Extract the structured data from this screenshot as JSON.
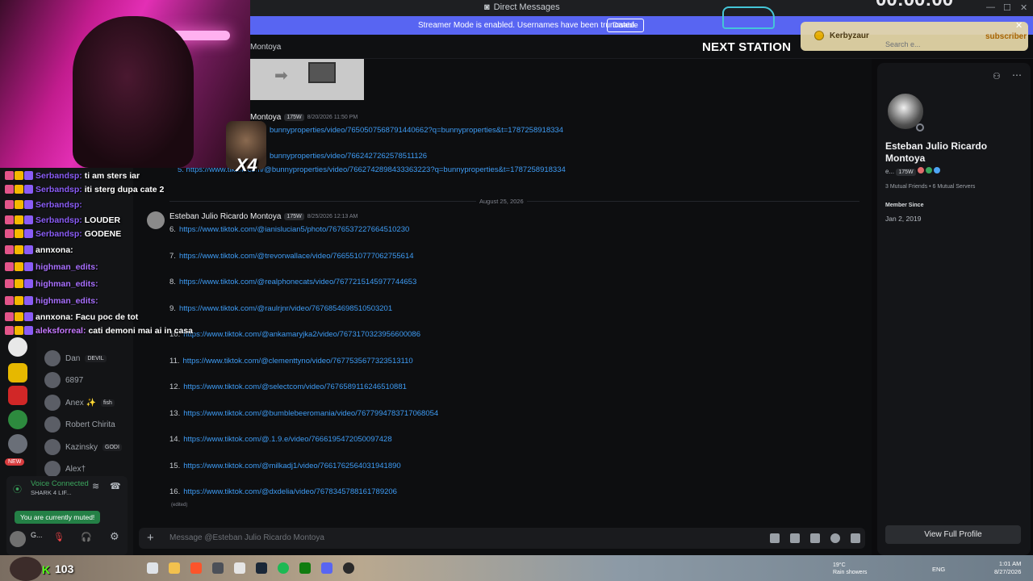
{
  "window": {
    "title": "Direct Messages",
    "controls": [
      "—",
      "☐",
      "✕"
    ]
  },
  "banner": {
    "message": "Streamer Mode is enabled. Usernames have been truncated.",
    "disable_label": "Disable"
  },
  "header": {
    "dm_name": "Montoya"
  },
  "overlay": {
    "next_station": "NEXT STATION",
    "timer": "00:00:00",
    "sub_alert": {
      "user": "Kerbyzaur",
      "type": "subscriber"
    },
    "search_placeholder": "Search e...",
    "viewers": "103",
    "multiplier": "X4"
  },
  "chat_overlay": [
    {
      "user": "Serbandsp:",
      "text": "ti am sters iar",
      "color": "#8a5cf6"
    },
    {
      "user": "Serbandsp:",
      "text": "iti sterg dupa cate 2",
      "color": "#8a5cf6"
    },
    {
      "user": "Serbandsp:",
      "text": "",
      "color": "#8a5cf6"
    },
    {
      "user": "Serbandsp:",
      "text": "LOUDER",
      "color": "#8a5cf6"
    },
    {
      "user": "Serbandsp:",
      "text": "GODENE",
      "color": "#8a5cf6"
    },
    {
      "user": "annxona:",
      "text": "",
      "color": "#ffffff"
    },
    {
      "user": "highman_edits:",
      "text": "",
      "color": "#a970ff"
    },
    {
      "user": "highman_edits:",
      "text": "",
      "color": "#a970ff"
    },
    {
      "user": "highman_edits:",
      "text": "",
      "color": "#a970ff"
    },
    {
      "user": "annxona:",
      "text": "Facu poc de tot",
      "color": "#ffffff"
    },
    {
      "user": "aleksforreal:",
      "text": "cati demoni mai ai in casa",
      "color": "#c678ff"
    }
  ],
  "dm_list": [
    {
      "name": "Dan",
      "tag": "DEVIL"
    },
    {
      "name": "6897",
      "tag": ""
    },
    {
      "name": "Anex ✨",
      "tag": "fish"
    },
    {
      "name": "Robert Chirita",
      "tag": ""
    },
    {
      "name": "Kazinsky",
      "tag": "GODI"
    },
    {
      "name": "Alex†",
      "tag": ""
    }
  ],
  "voice": {
    "status": "Voice Connected",
    "channel": "SHARK 4 LIF...",
    "muted_tooltip": "You are currently muted!",
    "user_short": "G..."
  },
  "messages": {
    "author": "Esteban Julio Ricardo Montoya",
    "author_short": "Montoya",
    "badge": "175W",
    "first_ts": "8/20/2026 11:50 PM",
    "first_links": [
      "bunnyproperties/video/7650507568791440662?q=bunnyproperties&t=1787258918334",
      "bunnyproperties/video/7662427262578511126",
      "5. https://www.tiktok.com/@bunnyproperties/video/7662742898433363223?q=bunnyproperties&t=1787258918334"
    ],
    "divider": "August 25, 2026",
    "second_ts": "8/25/2026 12:13 AM",
    "numbered": [
      {
        "n": "6.",
        "url": "https://www.tiktok.com/@ianislucian5/photo/7676537227664510230"
      },
      {
        "n": "7.",
        "url": "https://www.tiktok.com/@trevorwallace/video/7665510777062755614"
      },
      {
        "n": "8.",
        "url": "https://www.tiktok.com/@realphonecats/video/7677215145977744653"
      },
      {
        "n": "9.",
        "url": "https://www.tiktok.com/@raulrjnr/video/7676854698510503201"
      },
      {
        "n": "10.",
        "url": "https://www.tiktok.com/@ankamaryjka2/video/7673170323956600086"
      },
      {
        "n": "11.",
        "url": "https://www.tiktok.com/@clementtyno/video/7677535677323513110"
      },
      {
        "n": "12.",
        "url": "https://www.tiktok.com/@selectcom/video/7676589116246510881"
      },
      {
        "n": "13.",
        "url": "https://www.tiktok.com/@bumblebeeromania/video/7677994783717068054"
      },
      {
        "n": "14.",
        "url": "https://www.tiktok.com/@.1.9.e/video/7666195472050097428"
      },
      {
        "n": "15.",
        "url": "https://www.tiktok.com/@milkadj1/video/7661762564031941890"
      },
      {
        "n": "16.",
        "url": "https://www.tiktok.com/@dxdelia/video/7678345788161789206"
      }
    ],
    "edited": "(edited)"
  },
  "composer": {
    "placeholder": "Message @Esteban Julio Ricardo Montoya"
  },
  "profile": {
    "display_name": "Esteban Julio Ricardo Montoya",
    "username_short": "e...",
    "badge": "175W",
    "mutual": "3 Mutual Friends • 6 Mutual Servers",
    "member_since_label": "Member Since",
    "member_since": "Jan 2, 2019",
    "view_full_profile": "View Full Profile"
  },
  "taskbar": {
    "weather_temp": "19°C",
    "weather_desc": "Rain showers",
    "lang": "ENG",
    "time": "1:01 AM",
    "date": "8/27/2026"
  },
  "colors": {
    "accent": "#5865f2",
    "link": "#3e9cf5",
    "online": "#3ba55d"
  }
}
